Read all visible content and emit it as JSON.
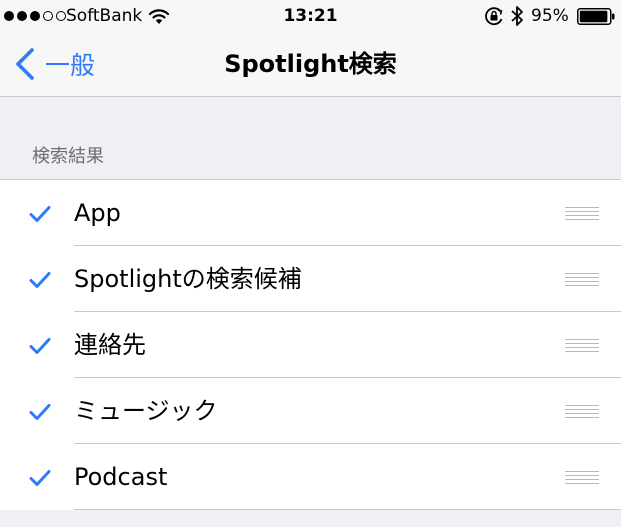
{
  "status_bar": {
    "signal": [
      true,
      true,
      true,
      false,
      false
    ],
    "carrier": "SoftBank",
    "time": "13:21",
    "battery_percent": "95%",
    "battery_level": 0.95
  },
  "nav": {
    "back_label": "一般",
    "title": "Spotlight検索"
  },
  "section": {
    "header": "検索結果"
  },
  "items": [
    {
      "label": "App",
      "checked": true
    },
    {
      "label": "Spotlightの検索候補",
      "checked": true
    },
    {
      "label": "連絡先",
      "checked": true
    },
    {
      "label": "ミュージック",
      "checked": true
    },
    {
      "label": "Podcast",
      "checked": true
    }
  ],
  "colors": {
    "accent": "#2f7bf6",
    "background": "#efeff4",
    "separator": "#c8c7cc"
  },
  "icons": {
    "back": "chevron-left-icon",
    "check": "checkmark-icon",
    "reorder": "reorder-grip-icon"
  }
}
